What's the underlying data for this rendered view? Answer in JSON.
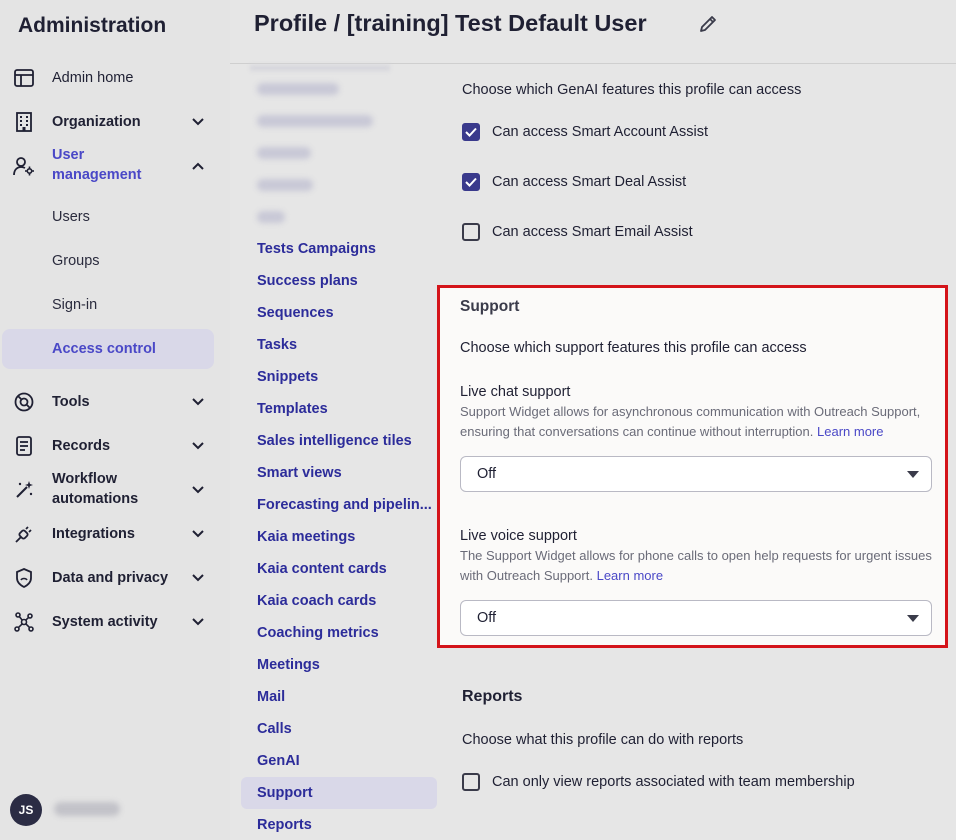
{
  "sidebar": {
    "title": "Administration",
    "items": {
      "admin_home": "Admin home",
      "organization": "Organization",
      "user_management_line1": "User",
      "user_management_line2": "management",
      "users": "Users",
      "groups": "Groups",
      "sign_in": "Sign-in",
      "access_control": "Access control",
      "tools": "Tools",
      "records": "Records",
      "workflow_line1": "Workflow",
      "workflow_line2": "automations",
      "integrations": "Integrations",
      "data_privacy": "Data and privacy",
      "system_activity": "System activity"
    },
    "user_initials": "JS"
  },
  "header": {
    "title": "Profile /  [training] Test Default User"
  },
  "sections": {
    "tests_campaigns": "Tests Campaigns",
    "success_plans": "Success plans",
    "sequences": "Sequences",
    "tasks": "Tasks",
    "snippets": "Snippets",
    "templates": "Templates",
    "sales_intelligence": "Sales intelligence tiles",
    "smart_views": "Smart views",
    "forecasting": "Forecasting and pipelin...",
    "kaia_meetings": "Kaia meetings",
    "kaia_content": "Kaia content cards",
    "kaia_coach": "Kaia coach cards",
    "coaching_metrics": "Coaching metrics",
    "meetings": "Meetings",
    "mail": "Mail",
    "calls": "Calls",
    "genai": "GenAI",
    "support": "Support",
    "reports": "Reports"
  },
  "genai": {
    "intro": "Choose which GenAI features this profile can access",
    "smart_account": "Can access Smart Account Assist",
    "smart_deal": "Can access Smart Deal Assist",
    "smart_email": "Can access Smart Email Assist"
  },
  "support": {
    "heading": "Support",
    "intro": "Choose which support features this profile can access",
    "live_chat_title": "Live chat support",
    "live_chat_desc": "Support Widget allows for asynchronous communication with Outreach Support, ensuring that conversations can continue without interruption.",
    "live_chat_link": "Learn more",
    "live_chat_value": "Off",
    "live_voice_title": "Live voice support",
    "live_voice_desc": "The Support Widget allows for phone calls to open help requests for urgent issues with Outreach Support.",
    "live_voice_link": "Learn more",
    "live_voice_value": "Off"
  },
  "reports": {
    "heading": "Reports",
    "intro": "Choose what this profile can do with reports",
    "team_membership": "Can only view reports associated with team membership"
  },
  "colors": {
    "accent": "#4a48c7",
    "checkbox": "#3a3a8c",
    "highlight_border": "#d4141a"
  }
}
